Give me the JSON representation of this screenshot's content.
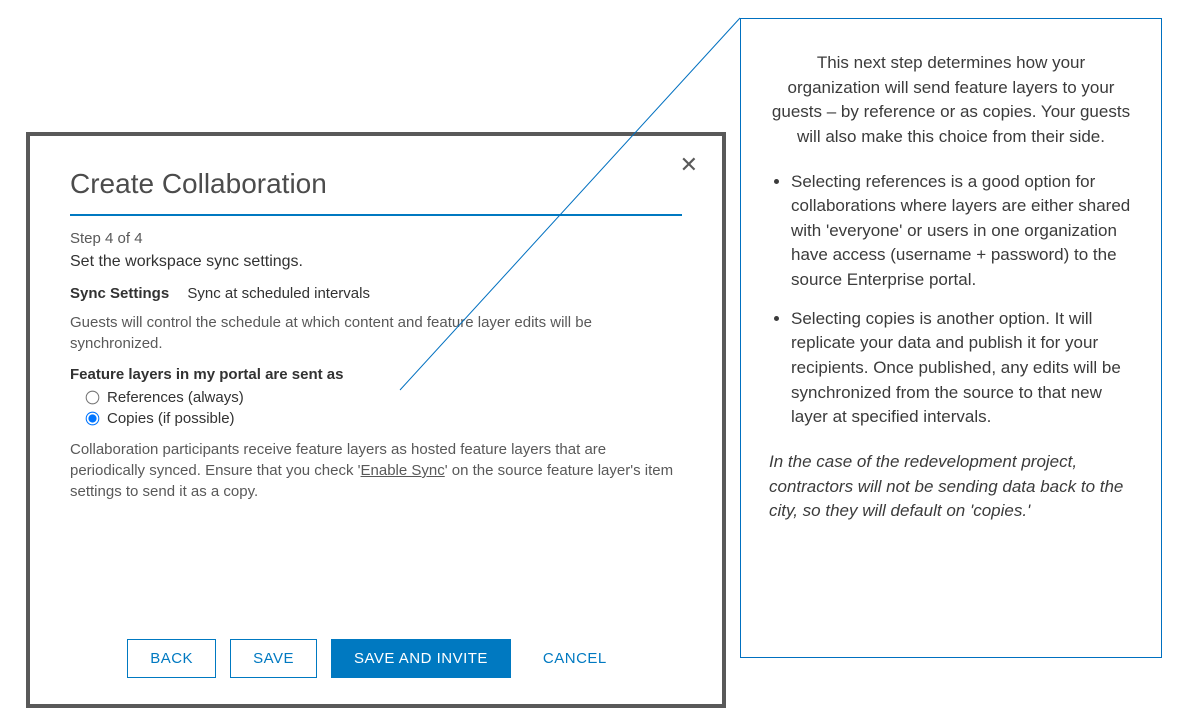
{
  "dialog": {
    "title": "Create Collaboration",
    "step": "Step 4 of 4",
    "subtitle": "Set the workspace sync settings.",
    "sync_label": "Sync Settings",
    "sync_value": "Sync at scheduled intervals",
    "sync_desc": "Guests will control the schedule at which content and feature layer edits will be synchronized.",
    "radio_title": "Feature layers in my portal are sent as",
    "radio_options": [
      {
        "label": "References (always)",
        "value": "references",
        "checked": false
      },
      {
        "label": "Copies (if possible)",
        "value": "copies",
        "checked": true
      }
    ],
    "copies_desc_pre": "Collaboration participants receive feature layers as hosted feature layers that are periodically synced. Ensure that you check '",
    "copies_desc_underline": "Enable Sync",
    "copies_desc_post": "' on the source feature layer's item settings to send it as a copy.",
    "buttons": {
      "back": "BACK",
      "save": "SAVE",
      "save_invite": "SAVE AND INVITE",
      "cancel": "CANCEL"
    },
    "close_symbol": "✕"
  },
  "panel": {
    "intro": "This next step determines how your organization will send feature layers to your guests – by reference or as copies. Your guests will also make this choice from their side.",
    "bullets": [
      "Selecting references is a good option for collaborations where layers are either shared with 'everyone' or users in one organization have access (username + password) to the source Enterprise portal.",
      "Selecting copies is another option. It will replicate your data and publish it for your recipients. Once published, any edits will be synchronized from the source to that new layer at specified intervals."
    ],
    "scenario": "In the case of the redevelopment project, contractors will not be sending data back to the city, so they will default on 'copies.'"
  }
}
